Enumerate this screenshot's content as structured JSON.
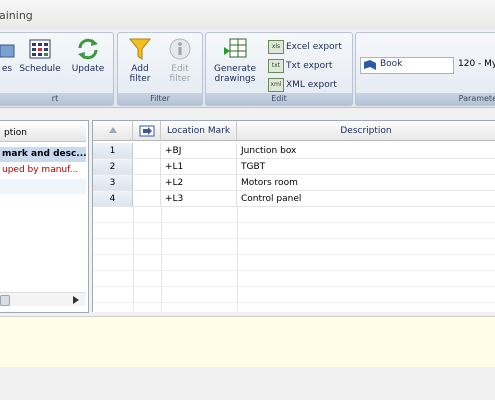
{
  "window": {
    "title": "aining"
  },
  "ribbon": {
    "groups": {
      "report_label": "rt",
      "filter_label": "Filter",
      "edit_label": "Edit",
      "parameters_label": "Paramete"
    },
    "buttons": {
      "types": "es",
      "schedule": "Schedule",
      "update": "Update",
      "add_filter": [
        "Add",
        "filter"
      ],
      "edit_filter": [
        "Edit",
        "filter"
      ],
      "generate_drawings": [
        "Generate",
        "drawings"
      ],
      "excel_export": "Excel export",
      "txt_export": "Txt export",
      "xml_export": "XML export"
    },
    "params": {
      "book_label": "Book",
      "book_value": "120 - My"
    }
  },
  "left_panel": {
    "header": "ption",
    "items": [
      "mark and desc...",
      "uped by manuf..."
    ]
  },
  "grid": {
    "columns": [
      "Location Mark",
      "Description"
    ],
    "rows": [
      {
        "num": "1",
        "mark": "+BJ",
        "description": "Junction box"
      },
      {
        "num": "2",
        "mark": "+L1",
        "description": "TGBT"
      },
      {
        "num": "3",
        "mark": "+L2",
        "description": "Motors room"
      },
      {
        "num": "4",
        "mark": "+L3",
        "description": "Control panel"
      }
    ]
  },
  "colors": {
    "ribbon_group_label_bg": "#b4c2d6",
    "notes_bg": "#fffde6",
    "selected_row_bg": "#c9d9f0",
    "red_text": "#b00000"
  }
}
